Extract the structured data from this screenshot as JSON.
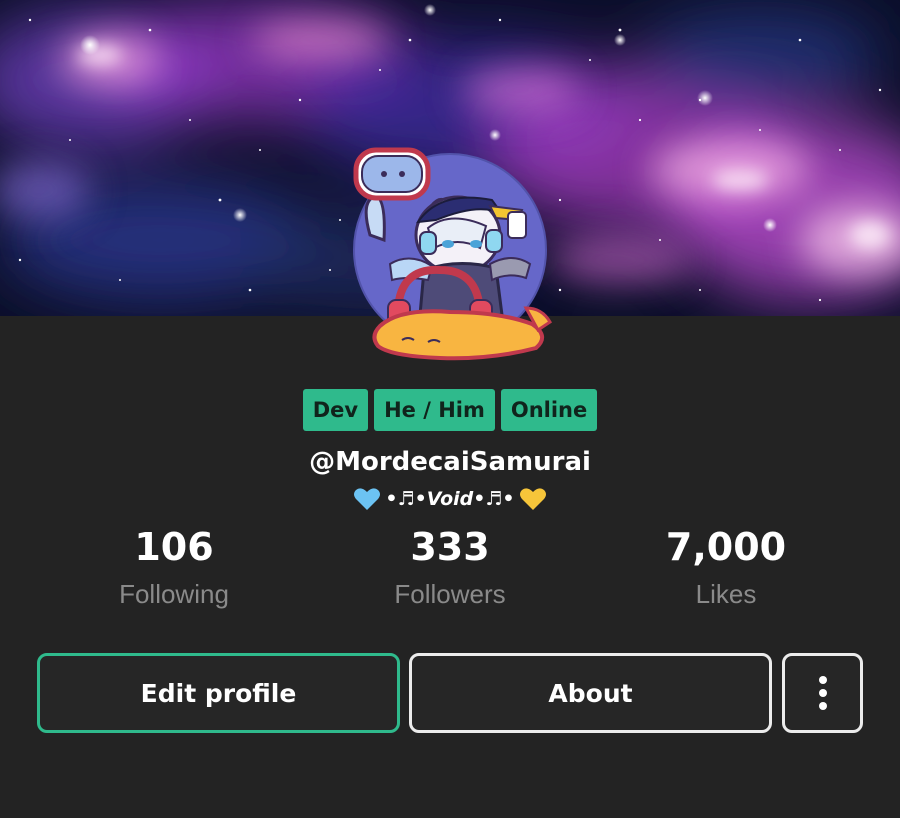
{
  "profile": {
    "tags": [
      "Dev",
      "He / Him",
      "Online"
    ],
    "username": "@MordecaiSamurai",
    "bio": {
      "left_emoji": "💙",
      "text": "•♬•Void•♬•",
      "right_emoji": "💛"
    }
  },
  "stats": [
    {
      "value": "106",
      "label": "Following"
    },
    {
      "value": "333",
      "label": "Followers"
    },
    {
      "value": "7,000",
      "label": "Likes"
    }
  ],
  "actions": {
    "edit_label": "Edit profile",
    "about_label": "About",
    "more_icon": "more-vertical-icon"
  },
  "colors": {
    "background": "#232323",
    "accent": "#2fba8c",
    "muted_text": "#8a8a8a",
    "banner_theme": "galaxy"
  }
}
